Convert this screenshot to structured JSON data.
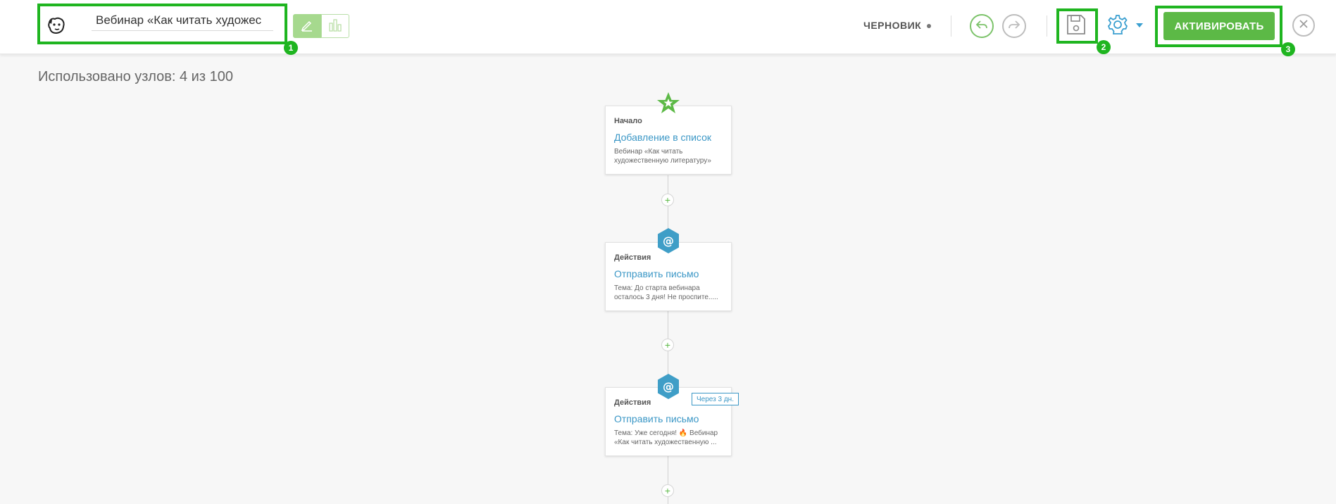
{
  "header": {
    "campaign_title": "Вебинар «Как читать художес",
    "status": "ЧЕРНОВИК",
    "activate_label": "АКТИВИРОВАТЬ",
    "accent_color": "#5cb946",
    "link_color": "#3b97c6"
  },
  "annotations": {
    "badge1": "1",
    "badge2": "2",
    "badge3": "3"
  },
  "usage_text": "Использовано узлов: 4 из 100",
  "nodes": [
    {
      "kind": "Начало",
      "name": "Добавление в список",
      "desc": "Вебинар «Как читать художественную литературу»",
      "icon": "star-icon"
    },
    {
      "kind": "Действия",
      "name": "Отправить письмо",
      "desc": "Тема: До старта вебинара осталось 3 дня! Не проспите.....",
      "icon": "email-at-icon"
    },
    {
      "kind": "Действия",
      "name": "Отправить письмо",
      "desc": "Тема: Уже сегодня! 🔥 Вебинар «Как читать художественную ...",
      "delay": "Через 3 дн.",
      "icon": "email-at-icon"
    }
  ],
  "plus_label": "+"
}
